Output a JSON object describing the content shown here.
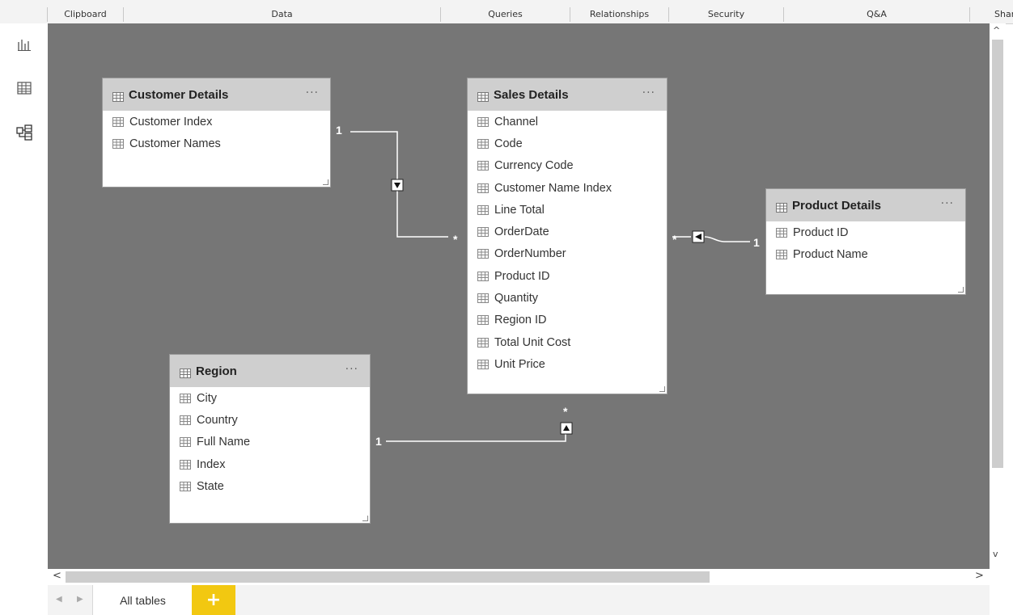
{
  "ribbon": {
    "groups": [
      "Clipboard",
      "Data",
      "Queries",
      "Relationships",
      "Security",
      "Q&A",
      "Share"
    ]
  },
  "rail": {
    "icons": [
      "report-view-icon",
      "data-view-icon",
      "model-view-icon"
    ]
  },
  "tables": {
    "customer": {
      "title": "Customer Details",
      "dots": "···",
      "fields": [
        "Customer Index",
        "Customer Names"
      ]
    },
    "sales": {
      "title": "Sales Details",
      "dots": "···",
      "fields": [
        "Channel",
        "Code",
        "Currency Code",
        "Customer Name Index",
        "Line Total",
        "OrderDate",
        "OrderNumber",
        "Product ID",
        "Quantity",
        "Region ID",
        "Total Unit Cost",
        "Unit Price"
      ]
    },
    "product": {
      "title": "Product Details",
      "dots": "···",
      "fields": [
        "Product ID",
        "Product Name"
      ]
    },
    "region": {
      "title": "Region",
      "dots": "···",
      "fields": [
        "City",
        "Country",
        "Full Name",
        "Index",
        "State"
      ]
    }
  },
  "relationships": {
    "one": "1",
    "many": "*"
  },
  "tabs": {
    "all_tables": "All tables",
    "add": "+",
    "prev": "◀",
    "next": "▶"
  },
  "scroll": {
    "up": "^",
    "down": "v",
    "left": "<",
    "right": ">"
  },
  "colors": {
    "canvas": "#767676",
    "card_header": "#cfcfcf",
    "accent": "#f2c811"
  }
}
